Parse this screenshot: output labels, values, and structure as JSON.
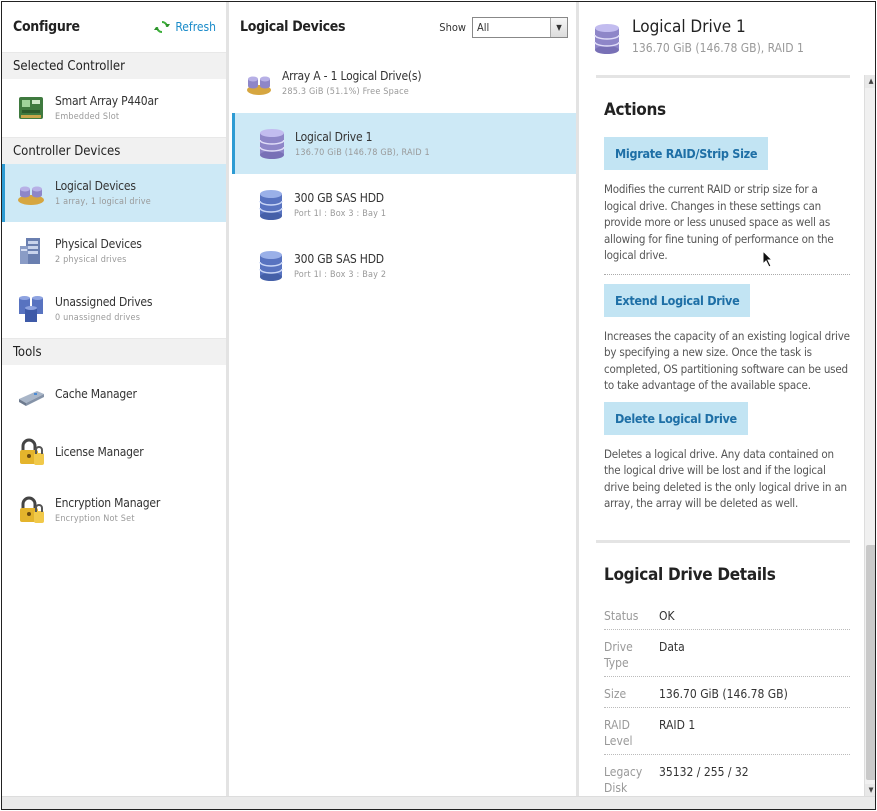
{
  "configure": {
    "title": "Configure",
    "refresh_label": "Refresh",
    "sections": {
      "selected_controller": "Selected Controller",
      "controller_devices": "Controller Devices",
      "tools": "Tools"
    },
    "controller": {
      "label": "Smart Array P440ar",
      "sub": "Embedded Slot",
      "icon": "controller-card-icon"
    },
    "devices": [
      {
        "label": "Logical Devices",
        "sub": "1 array, 1 logical drive",
        "icon": "logical-devices-icon"
      },
      {
        "label": "Physical Devices",
        "sub": "2 physical drives",
        "icon": "physical-devices-icon"
      },
      {
        "label": "Unassigned Drives",
        "sub": "0 unassigned drives",
        "icon": "unassigned-drives-icon"
      }
    ],
    "tools": [
      {
        "label": "Cache Manager",
        "icon": "cache-manager-icon"
      },
      {
        "label": "License Manager",
        "icon": "padlock-icon"
      },
      {
        "label": "Encryption Manager",
        "sub": "Encryption Not Set",
        "icon": "padlock-icon"
      }
    ]
  },
  "logical_devices": {
    "title": "Logical Devices",
    "show_label": "Show",
    "show_value": "All",
    "items": [
      {
        "label": "Array A - 1 Logical Drive(s)",
        "sub": "285.3 GiB (51.1%) Free Space",
        "icon": "array-icon"
      },
      {
        "label": "Logical Drive 1",
        "sub": "136.70 GiB (146.78 GB), RAID 1",
        "icon": "logical-drive-icon"
      },
      {
        "label": "300 GB SAS HDD",
        "sub": "Port 1I : Box 3 : Bay 1",
        "icon": "hdd-icon"
      },
      {
        "label": "300 GB SAS HDD",
        "sub": "Port 1I : Box 3 : Bay 2",
        "icon": "hdd-icon"
      }
    ]
  },
  "detail": {
    "title": "Logical Drive 1",
    "subtitle": "136.70 GiB (146.78 GB), RAID 1",
    "actions_title": "Actions",
    "actions": [
      {
        "label": "Migrate RAID/Strip Size",
        "desc": "Modifies the current RAID or strip size for a logical drive. Changes in these settings can provide more or less unused space as well as allowing for fine tuning of performance on the logical drive."
      },
      {
        "label": "Extend Logical Drive",
        "desc": "Increases the capacity of an existing logical drive by specifying a new size. Once the task is completed, OS partitioning software can be used to take advantage of the available space."
      },
      {
        "label": "Delete Logical Drive",
        "desc": "Deletes a logical drive. Any data contained on the logical drive will be lost and if the logical drive being deleted is the only logical drive in an array, the array will be deleted as well."
      }
    ],
    "details_title": "Logical Drive Details",
    "details": [
      {
        "key": "Status",
        "value": "OK"
      },
      {
        "key": "Drive Type",
        "value": "Data"
      },
      {
        "key": "Size",
        "value": "136.70 GiB (146.78 GB)"
      },
      {
        "key": "RAID Level",
        "value": "RAID 1"
      },
      {
        "key": "Legacy Disk",
        "value": "35132 / 255 / 32"
      }
    ]
  },
  "colors": {
    "selected_bg": "#cde9f6",
    "selected_accent": "#2d9bd3",
    "action_btn_bg": "#c2e4f3",
    "action_btn_text": "#1e6fa6",
    "refresh_text": "#1a8bc9"
  }
}
